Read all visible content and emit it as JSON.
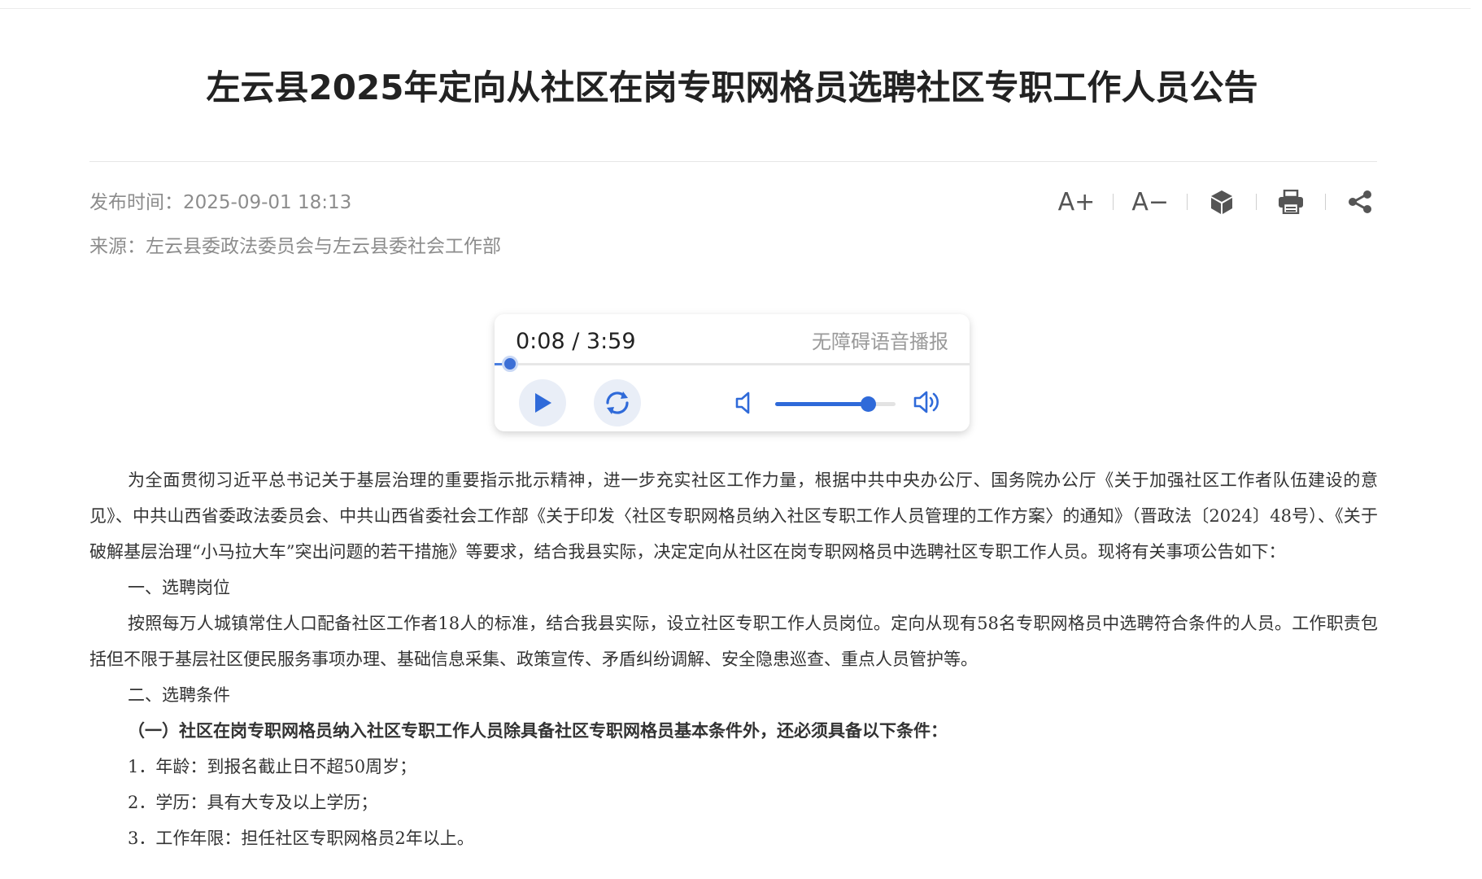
{
  "article": {
    "title": "左云县2025年定向从社区在岗专职网格员选聘社区专职工作人员公告",
    "publish_time": "发布时间：2025-09-01 18:13",
    "source": "来源：左云县委政法委员会与左云县委社会工作部"
  },
  "tools": {
    "font_increase_label": "A+",
    "font_decrease_label": "A−",
    "icons": [
      "cube-icon",
      "printer-icon",
      "share-icon"
    ]
  },
  "audio_player": {
    "time_display": "0:08 / 3:59",
    "label": "无障碍语音播报",
    "progress_fraction": 0.033,
    "volume_fraction": 0.78,
    "accent_color": "#2f6ad9"
  },
  "body": {
    "paragraphs": [
      "为全面贯彻习近平总书记关于基层治理的重要指示批示精神，进一步充实社区工作力量，根据中共中央办公厅、国务院办公厅《关于加强社区工作者队伍建设的意见》、中共山西省委政法委员会、中共山西省委社会工作部《关于印发〈社区专职网格员纳入社区专职工作人员管理的工作方案〉的通知》（晋政法〔2024〕48号）、《关于破解基层治理“小马拉大车”突出问题的若干措施》等要求，结合我县实际，决定定向从社区在岗专职网格员中选聘社区专职工作人员。现将有关事项公告如下：",
      "一、选聘岗位",
      "按照每万人城镇常住人口配备社区工作者18人的标准，结合我县实际，设立社区专职工作人员岗位。定向从现有58名专职网格员中选聘符合条件的人员。工作职责包括但不限于基层社区便民服务事项办理、基础信息采集、政策宣传、矛盾纠纷调解、安全隐患巡查、重点人员管护等。",
      "二、选聘条件",
      "（一）社区在岗专职网格员纳入社区专职工作人员除具备社区专职网格员基本条件外，还必须具备以下条件：",
      "1．年龄：到报名截止日不超50周岁；",
      "2．学历：具有大专及以上学历；",
      "3．工作年限：担任社区专职网格员2年以上。"
    ]
  }
}
